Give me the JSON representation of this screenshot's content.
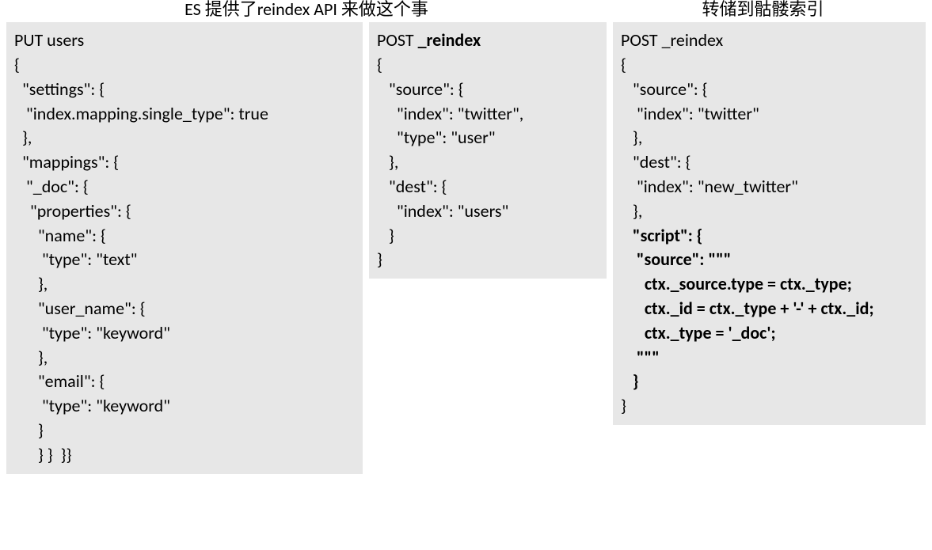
{
  "headings": {
    "left": "ES 提供了reindex API 来做这个事",
    "right": "转储到骷髅索引"
  },
  "blocks": {
    "put_users": {
      "l0": "PUT users",
      "l1": "{",
      "l2": "  \"settings\": {",
      "l3": "   \"index.mapping.single_type\": true",
      "l4": "  },",
      "l5": "  \"mappings\": {",
      "l6": "   \"_doc\": {",
      "l7": "    \"properties\": {",
      "l8": "      \"name\": {",
      "l9": "       \"type\": \"text\"",
      "l10": "      },",
      "l11": "      \"user_name\": {",
      "l12": "       \"type\": \"keyword\"",
      "l13": "      },",
      "l14": "      \"email\": {",
      "l15": "       \"type\": \"keyword\"",
      "l16": "      }",
      "l17": "      } }  }}"
    },
    "reindex1": {
      "l0": "POST ",
      "l0b": "_reindex",
      "l1": "{",
      "l2": "   \"source\": {",
      "l3": "     \"index\": \"twitter\",",
      "l4": "     \"type\": \"user\"",
      "l5": "   },",
      "l6": "   \"dest\": {",
      "l7": "     \"index\": \"users\"",
      "l8": "   }",
      "l9": "}"
    },
    "reindex2": {
      "l0": "POST _reindex",
      "l1": "{",
      "l2": "   \"source\": {",
      "l3": "    \"index\": \"twitter\"",
      "l4": "   },",
      "l5": "   \"dest\": {",
      "l6": "    \"index\": \"new_twitter\"",
      "l7": "   },",
      "l8b": "   \"script\": {",
      "l9b": "    \"source\": \"\"\"",
      "l10b": "      ctx._source.type = ctx._type;",
      "l11b": "      ctx._id = ctx._type + '-' + ctx._id;",
      "l12b": "      ctx._type = '_doc';",
      "l13b": "    \"\"\"",
      "l14b": "   }",
      "l15": "}"
    }
  }
}
